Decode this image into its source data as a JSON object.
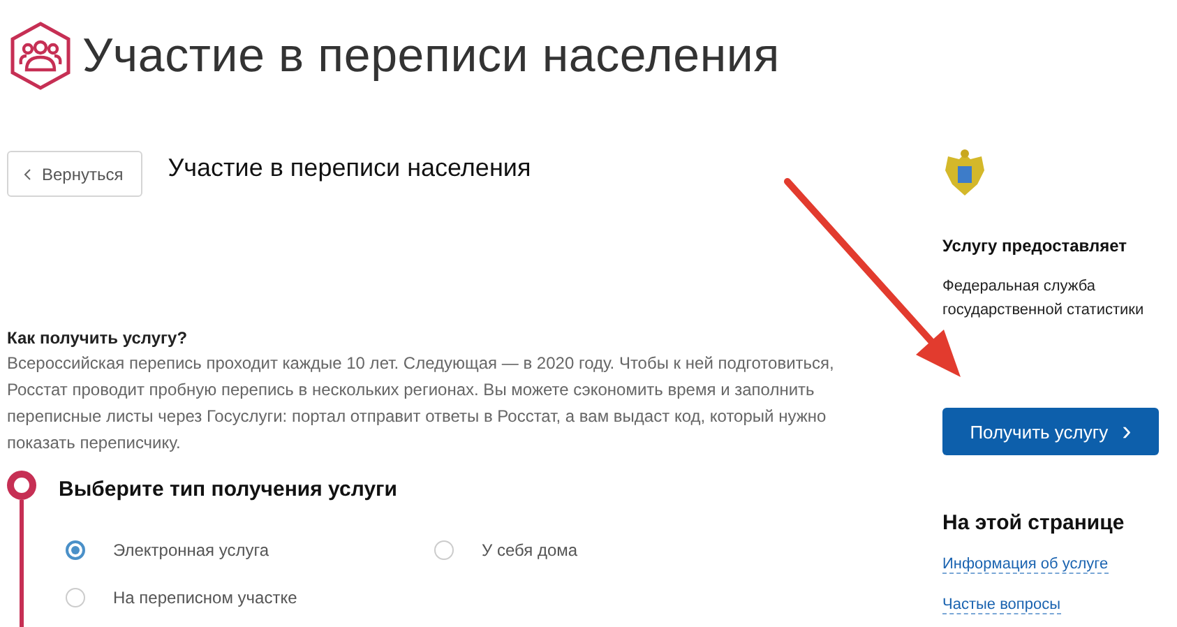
{
  "header": {
    "title": "Участие в переписи населения"
  },
  "back_button": {
    "label": "Вернуться"
  },
  "service_title": "Участие в переписи населения",
  "info": {
    "heading": "Как получить услугу?",
    "text": "Всероссийская перепись проходит каждые 10 лет. Следующая — в 2020 году. Чтобы к ней подготовиться, Росстат проводит пробную перепись в нескольких регионах. Вы можете сэкономить время и заполнить переписные листы через Госуслуги: портал отправит ответы в Росстат, а вам выдаст код, который нужно показать переписчику."
  },
  "step": {
    "title": "Выберите тип получения услуги",
    "options": [
      {
        "label": "Электронная услуга",
        "selected": true
      },
      {
        "label": "У себя дома",
        "selected": false
      },
      {
        "label": "На переписном участке",
        "selected": false
      }
    ]
  },
  "provider": {
    "heading": "Услугу предоставляет",
    "name": "Федеральная служба государственной статистики"
  },
  "get_button": {
    "label": "Получить услугу",
    "arrow": "›"
  },
  "on_page": {
    "heading": "На этой странице",
    "links": [
      "Информация об услуге",
      "Частые вопросы"
    ]
  }
}
